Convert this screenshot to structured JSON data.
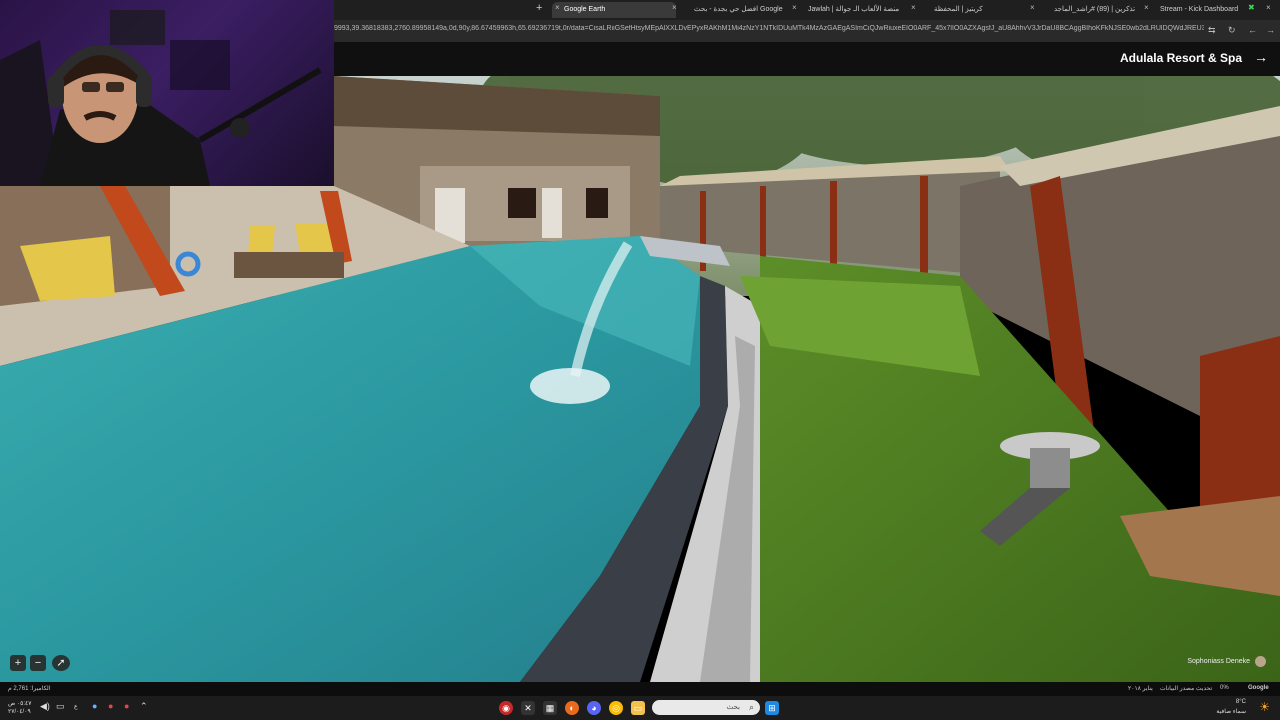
{
  "browser": {
    "tabs": [
      {
        "label": "Google Earth",
        "active": true
      },
      {
        "label": "افضل حي بجدة - بحث Google",
        "active": false
      },
      {
        "label": "Jawlah | منصة الألعاب الـ جوالة",
        "active": false
      },
      {
        "label": "كريتيز | المحفظة",
        "active": false
      },
      {
        "label": "تذكرين | (89) #راشد_الماجد",
        "active": false
      },
      {
        "label": "Stream - Kick Dashboard",
        "active": false
      }
    ],
    "new_tab_symbol": "+",
    "url": "9993,39.36818383,2760.89958149a,0d,90y,86.67459963h,65.69236719t,0r/data=CisaLRiiGSefHtsyMEpAlXXLDvEPyxRAKhM1Mi4zNzY1NTkIDUuMTk4MzAzGAEgASImCiQJwRiuxeEIO0ARF_45x7lIO0AZXAgsfJ_aU8AhhvV3JrDaU8BCAggBIhoKFkNJSE0wb2dLRUlDQWdJREU3cXFaV0VQBB..."
  },
  "earth": {
    "place_name": "Adulala Resort & Spa",
    "arrow_icon": "arrow-right-icon",
    "attribution": "Sophoniass Deneke",
    "zoom_in": "+",
    "zoom_out": "−",
    "compass_icon": "compass-icon"
  },
  "statusbar": {
    "camera": "الكاميرا: 2,761 م",
    "google": "Google",
    "percent": "0%",
    "data_updating": "تحديث مصدر البيانات",
    "date": "يناير ٢٠١٨"
  },
  "taskbar": {
    "search_placeholder": "بحث",
    "time": "٠٥:٤٧ ص",
    "date": "٢٧/٠٤/٠٩",
    "weather": "8°C",
    "weather_desc": "سماء صافية",
    "lang": "ع"
  },
  "colors": {
    "pool": "#2aa3a8",
    "grass": "#4a7a22",
    "accent_tab": "#3a3a3a"
  }
}
